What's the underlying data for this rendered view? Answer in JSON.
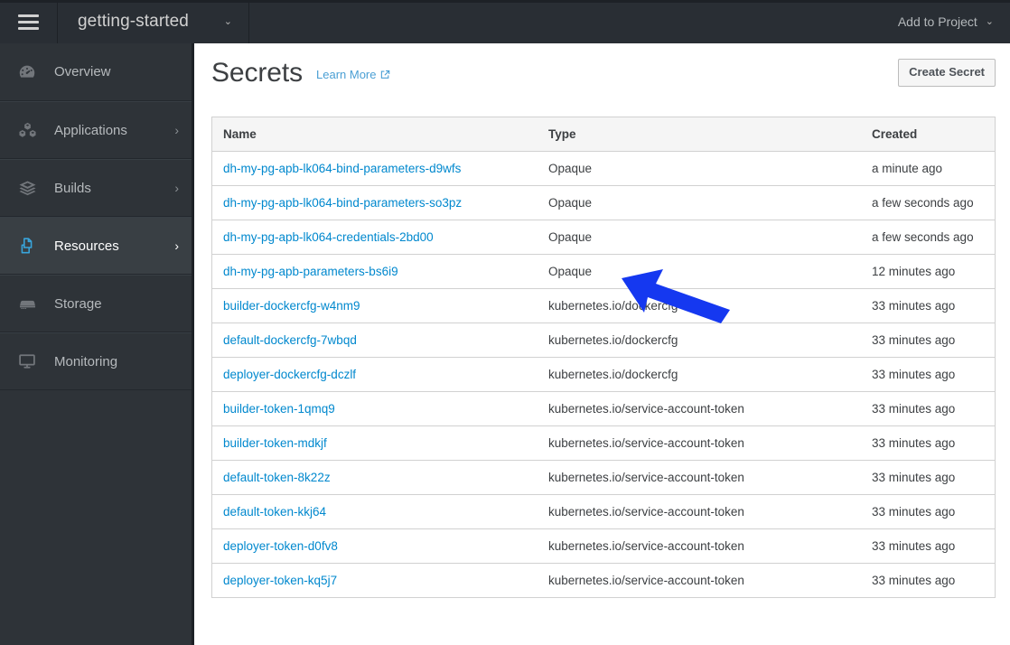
{
  "topbar": {
    "menu_icon": "hamburger-icon",
    "project_name": "getting-started",
    "project_caret": "⌄",
    "add_to_project_label": "Add to Project",
    "add_to_project_caret": "⌄"
  },
  "sidebar": {
    "items": [
      {
        "label": "Overview",
        "icon": "dashboard-icon",
        "has_chevron": false,
        "active": false
      },
      {
        "label": "Applications",
        "icon": "cubes-icon",
        "has_chevron": true,
        "active": false
      },
      {
        "label": "Builds",
        "icon": "layers-icon",
        "has_chevron": true,
        "active": false
      },
      {
        "label": "Resources",
        "icon": "documents-icon",
        "has_chevron": true,
        "active": true
      },
      {
        "label": "Storage",
        "icon": "storage-icon",
        "has_chevron": false,
        "active": false
      },
      {
        "label": "Monitoring",
        "icon": "monitor-icon",
        "has_chevron": false,
        "active": false
      }
    ],
    "chevron_glyph": "›"
  },
  "main": {
    "title": "Secrets",
    "learn_more_label": "Learn More",
    "learn_more_icon": "external-link-icon",
    "create_button_label": "Create Secret"
  },
  "table": {
    "columns": [
      "Name",
      "Type",
      "Created"
    ],
    "rows": [
      {
        "name": "dh-my-pg-apb-lk064-bind-parameters-d9wfs",
        "type": "Opaque",
        "created": "a minute ago"
      },
      {
        "name": "dh-my-pg-apb-lk064-bind-parameters-so3pz",
        "type": "Opaque",
        "created": "a few seconds ago"
      },
      {
        "name": "dh-my-pg-apb-lk064-credentials-2bd00",
        "type": "Opaque",
        "created": "a few seconds ago"
      },
      {
        "name": "dh-my-pg-apb-parameters-bs6i9",
        "type": "Opaque",
        "created": "12 minutes ago"
      },
      {
        "name": "builder-dockercfg-w4nm9",
        "type": "kubernetes.io/dockercfg",
        "created": "33 minutes ago"
      },
      {
        "name": "default-dockercfg-7wbqd",
        "type": "kubernetes.io/dockercfg",
        "created": "33 minutes ago"
      },
      {
        "name": "deployer-dockercfg-dczlf",
        "type": "kubernetes.io/dockercfg",
        "created": "33 minutes ago"
      },
      {
        "name": "builder-token-1qmq9",
        "type": "kubernetes.io/service-account-token",
        "created": "33 minutes ago"
      },
      {
        "name": "builder-token-mdkjf",
        "type": "kubernetes.io/service-account-token",
        "created": "33 minutes ago"
      },
      {
        "name": "default-token-8k22z",
        "type": "kubernetes.io/service-account-token",
        "created": "33 minutes ago"
      },
      {
        "name": "default-token-kkj64",
        "type": "kubernetes.io/service-account-token",
        "created": "33 minutes ago"
      },
      {
        "name": "deployer-token-d0fv8",
        "type": "kubernetes.io/service-account-token",
        "created": "33 minutes ago"
      },
      {
        "name": "deployer-token-kq5j7",
        "type": "kubernetes.io/service-account-token",
        "created": "33 minutes ago"
      }
    ]
  },
  "annotation": {
    "type": "arrow",
    "color": "#1538f0",
    "points_at": "dh-my-pg-apb-lk064-credentials-2bd00"
  },
  "colors": {
    "topbar_bg": "#292e34",
    "sidebar_bg": "#2e3338",
    "sidebar_active_bg": "#393f44",
    "accent_blue": "#0088ce",
    "active_icon_blue": "#39a5dc",
    "link_blue": "#4a9fd4",
    "annotation_blue": "#1538f0",
    "table_border": "#d1d1d1",
    "table_head_bg": "#f5f5f5"
  }
}
